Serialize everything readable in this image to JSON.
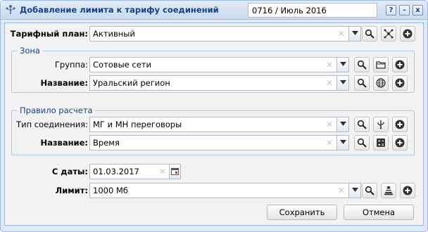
{
  "window": {
    "title": "Добавление лимита к тарифу соединений",
    "period": "0716 / Июль 2016",
    "tools": {
      "help": "?",
      "minimize": "–",
      "close": "x"
    }
  },
  "form": {
    "tariff_plan": {
      "label": "Тарифный план:",
      "value": "Активный"
    },
    "zone": {
      "legend": "Зона",
      "group": {
        "label": "Группа:",
        "value": "Сотовые сети"
      },
      "name": {
        "label": "Название:",
        "value": "Уральский регион"
      }
    },
    "rule": {
      "legend": "Правило расчета",
      "connection_type": {
        "label": "Тип соединения:",
        "value": "МГ и МН переговоры"
      },
      "name": {
        "label": "Название:",
        "value": "Время"
      }
    },
    "start_date": {
      "label": "С даты:",
      "value": "01.03.2017"
    },
    "limit": {
      "label": "Лимит:",
      "value": "1000 Мб"
    }
  },
  "buttons": {
    "save": "Сохранить",
    "cancel": "Отмена"
  },
  "icons": {
    "search": "search-icon",
    "network": "network-icon",
    "add": "plus-circle-icon",
    "folder": "folder-icon",
    "globe": "globe-icon",
    "usb": "usb-icon",
    "calculator": "calculator-icon",
    "cone": "cone-icon",
    "calendar": "calendar-icon"
  }
}
